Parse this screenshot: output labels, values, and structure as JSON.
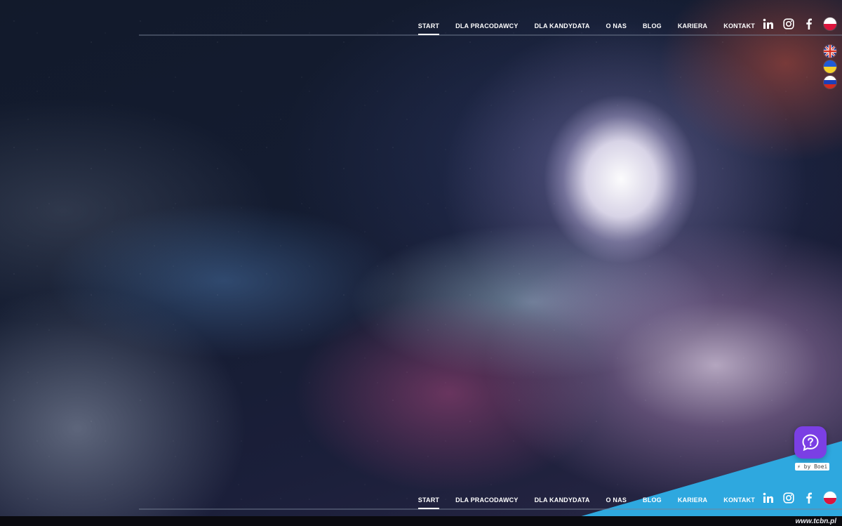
{
  "nav": {
    "items": [
      {
        "label": "START",
        "active": true
      },
      {
        "label": "DLA PRACODAWCY",
        "active": false
      },
      {
        "label": "DLA KANDYDATA",
        "active": false
      },
      {
        "label": "O NAS",
        "active": false
      },
      {
        "label": "BLOG",
        "active": false
      },
      {
        "label": "KARIERA",
        "active": false
      },
      {
        "label": "KONTAKT",
        "active": false
      }
    ],
    "social": [
      "linkedin-icon",
      "instagram-icon",
      "facebook-icon"
    ],
    "current_language": "pl-flag-icon"
  },
  "languages": [
    "uk-flag-icon",
    "ua-flag-icon",
    "ru-flag-icon"
  ],
  "chat_widget": {
    "icon": "chat-question-icon",
    "credit": "⚡ by Boei",
    "color": "#7b3fe4"
  },
  "footer": {
    "url": "www.tcbn.pl",
    "accent_color": "#2ea8df"
  }
}
